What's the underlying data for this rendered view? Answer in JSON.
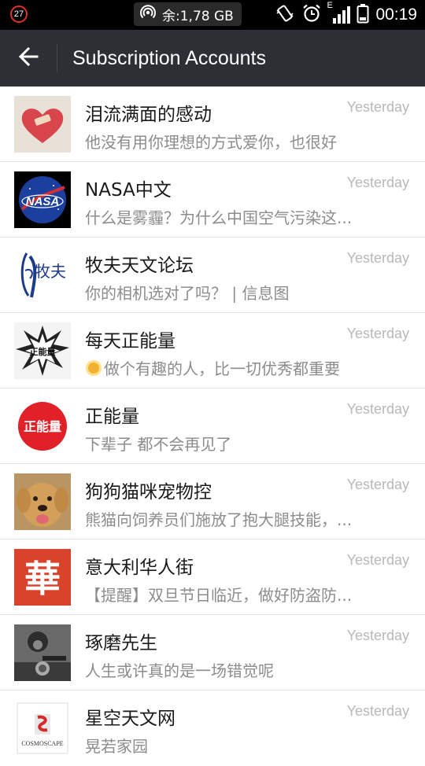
{
  "status_bar": {
    "notification_count": "27",
    "storage_text": "余:1,78 GB",
    "network_letter": "E",
    "time": "00:19"
  },
  "header": {
    "title": "Subscription Accounts"
  },
  "accounts": [
    {
      "name": "泪流满面的感动",
      "preview": "他没有用你理想的方式爱你，也很好",
      "time": "Yesterday"
    },
    {
      "name": "NASA中文",
      "preview": "什么是雾霾？为什么中国空气污染这...",
      "time": "Yesterday",
      "avatar_text": "NASA"
    },
    {
      "name": "牧夫天文论坛",
      "preview": "你的相机选对了吗？ | 信息图",
      "time": "Yesterday",
      "avatar_text": "牧夫"
    },
    {
      "name": "每天正能量",
      "preview": "做个有趣的人，比一切优秀都重要",
      "time": "Yesterday",
      "avatar_text": "正能量"
    },
    {
      "name": "正能量",
      "preview": "下辈子 都不会再见了",
      "time": "Yesterday",
      "avatar_text": "正能量"
    },
    {
      "name": "狗狗猫咪宠物控",
      "preview": "熊猫向饲养员们施放了抱大腿技能，...",
      "time": "Yesterday"
    },
    {
      "name": "意大利华人街",
      "preview": "【提醒】双旦节日临近，做好防盗防...",
      "time": "Yesterday",
      "avatar_text": "華"
    },
    {
      "name": "琢磨先生",
      "preview": "人生或许真的是一场错觉呢",
      "time": "Yesterday"
    },
    {
      "name": "星空天文网",
      "preview": "晃若家园",
      "time": "Yesterday",
      "avatar_text": "COSMOSCAPE"
    }
  ],
  "colors": {
    "status_bar_bg": "#000000",
    "header_bg": "#2c2f33",
    "name_text": "#1a1a1a",
    "preview_text": "#8c8c8c",
    "timestamp_text": "#b8b8b8",
    "badge_red": "#e0302a"
  },
  "icons": {
    "back": "arrow-left-icon",
    "hotspot": "hotspot-icon",
    "vibrate": "vibrate-icon",
    "alarm": "alarm-icon",
    "signal": "signal-icon",
    "battery": "battery-icon",
    "sun_emoji": "sun-icon"
  }
}
